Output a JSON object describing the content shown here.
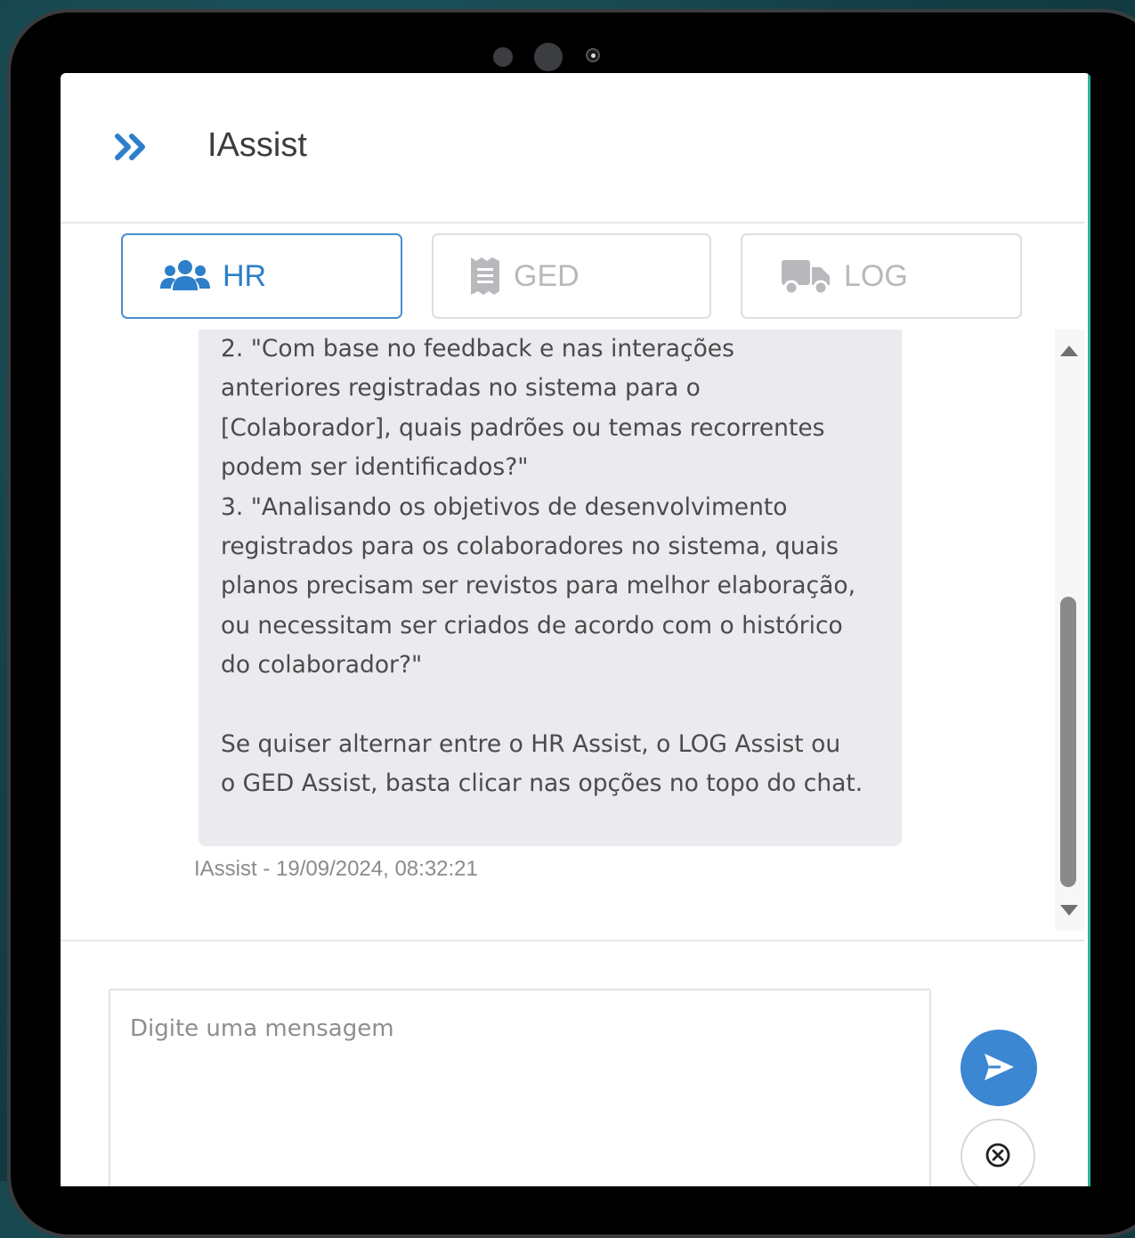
{
  "header": {
    "title": "IAssist",
    "toggle_icon": "double-chevron-right-icon"
  },
  "tabs": [
    {
      "label": "HR",
      "icon": "users-icon",
      "active": true
    },
    {
      "label": "GED",
      "icon": "receipt-document-icon",
      "active": false
    },
    {
      "label": "LOG",
      "icon": "truck-icon",
      "active": false
    }
  ],
  "message": {
    "lines": [
      " 2. \"Com base no feedback e nas interações",
      "anteriores registradas no sistema para o",
      "[Colaborador], quais padrões ou temas recorrentes",
      "podem ser identificados?\"",
      " 3. \"Analisando os objetivos de desenvolvimento",
      "registrados para os colaboradores no sistema, quais",
      "planos precisam ser revistos para melhor elaboração,",
      "ou necessitam ser criados de acordo com o histórico",
      "do colaborador?\"",
      "",
      "Se quiser alternar entre o HR Assist, o LOG Assist ou",
      "o GED Assist, basta clicar nas opções no topo do chat."
    ],
    "meta": "IAssist - 19/09/2024, 08:32:21"
  },
  "composer": {
    "placeholder": "Digite uma mensagem",
    "value": "",
    "send_icon": "send-icon",
    "clear_icon": "close-circle-icon"
  },
  "colors": {
    "accent": "#3b87d2",
    "active_tab_text": "#2d7fc9",
    "inactive_tab_text": "#b9b9bd",
    "bubble_bg": "#ebeaee"
  }
}
